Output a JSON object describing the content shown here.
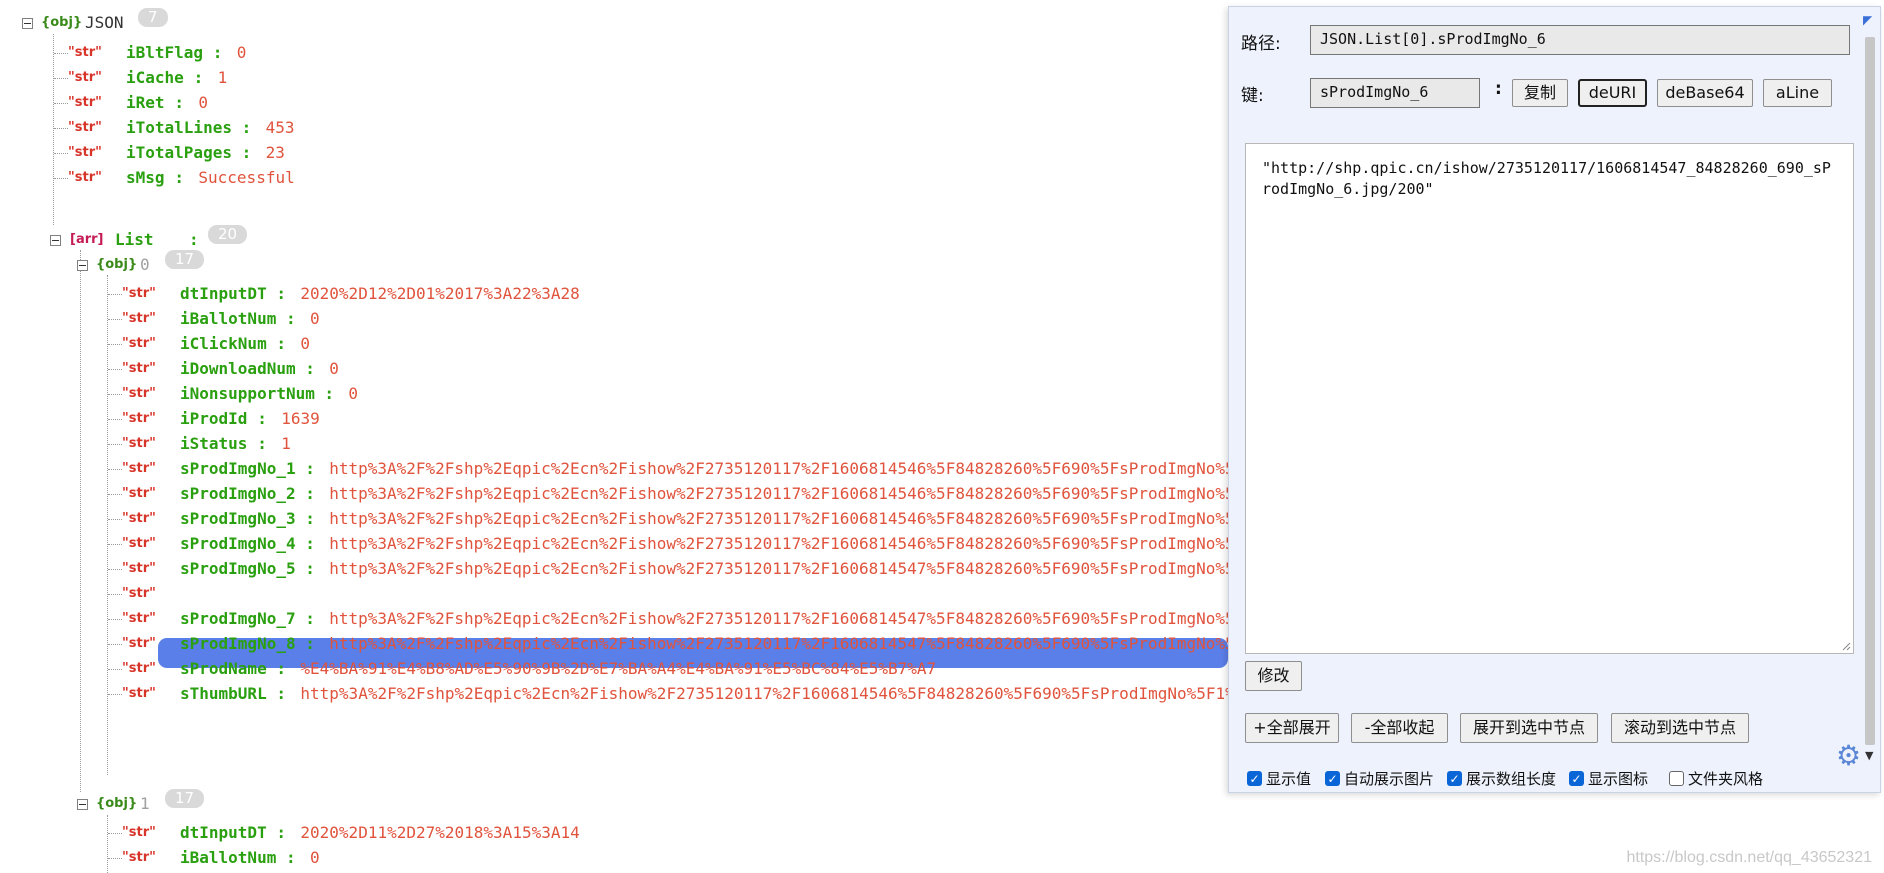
{
  "tree": {
    "root": {
      "type_tag": "{obj}",
      "name": "JSON",
      "count": "7"
    },
    "root_items": [
      {
        "type_tag": "\"str\"",
        "key": "iBltFlag",
        "value": "0"
      },
      {
        "type_tag": "\"str\"",
        "key": "iCache",
        "value": "1"
      },
      {
        "type_tag": "\"str\"",
        "key": "iRet",
        "value": "0"
      },
      {
        "type_tag": "\"str\"",
        "key": "iTotalLines",
        "value": "453"
      },
      {
        "type_tag": "\"str\"",
        "key": "iTotalPages",
        "value": "23"
      },
      {
        "type_tag": "\"str\"",
        "key": "sMsg",
        "value": "Successful"
      }
    ],
    "list": {
      "type_tag": "[arr]",
      "key": "List",
      "count": "20"
    },
    "obj0": {
      "type_tag": "{obj}",
      "index": "0",
      "count": "17"
    },
    "obj0_items": [
      {
        "type_tag": "\"str\"",
        "key": "dtInputDT",
        "value": "2020%2D12%2D01%2017%3A22%3A28"
      },
      {
        "type_tag": "\"str\"",
        "key": "iBallotNum",
        "value": "0"
      },
      {
        "type_tag": "\"str\"",
        "key": "iClickNum",
        "value": "0"
      },
      {
        "type_tag": "\"str\"",
        "key": "iDownloadNum",
        "value": "0"
      },
      {
        "type_tag": "\"str\"",
        "key": "iNonsupportNum",
        "value": "0"
      },
      {
        "type_tag": "\"str\"",
        "key": "iProdId",
        "value": "1639"
      },
      {
        "type_tag": "\"str\"",
        "key": "iStatus",
        "value": "1"
      },
      {
        "type_tag": "\"str\"",
        "key": "sProdImgNo_1",
        "value": "http%3A%2F%2Fshp%2Eqpic%2Ecn%2Fishow%2F2735120117%2F1606814546%5F84828260%5F690%5FsProdImgNo%5"
      },
      {
        "type_tag": "\"str\"",
        "key": "sProdImgNo_2",
        "value": "http%3A%2F%2Fshp%2Eqpic%2Ecn%2Fishow%2F2735120117%2F1606814546%5F84828260%5F690%5FsProdImgNo%5"
      },
      {
        "type_tag": "\"str\"",
        "key": "sProdImgNo_3",
        "value": "http%3A%2F%2Fshp%2Eqpic%2Ecn%2Fishow%2F2735120117%2F1606814546%5F84828260%5F690%5FsProdImgNo%5"
      },
      {
        "type_tag": "\"str\"",
        "key": "sProdImgNo_4",
        "value": "http%3A%2F%2Fshp%2Eqpic%2Ecn%2Fishow%2F2735120117%2F1606814546%5F84828260%5F690%5FsProdImgNo%5"
      },
      {
        "type_tag": "\"str\"",
        "key": "sProdImgNo_5",
        "value": "http%3A%2F%2Fshp%2Eqpic%2Ecn%2Fishow%2F2735120117%2F1606814547%5F84828260%5F690%5FsProdImgNo%5"
      },
      {
        "type_tag": "\"str\"",
        "key": "sProdImgNo_6",
        "value": "http%3A%2F%2Fshp%2Eqpic%2Ecn%2Fishow%2F2735120117%2F1606814547%5F84828260%5F690%5FsProdImgNo%5",
        "selected": true
      },
      {
        "type_tag": "\"str\"",
        "key": "sProdImgNo_7",
        "value": "http%3A%2F%2Fshp%2Eqpic%2Ecn%2Fishow%2F2735120117%2F1606814547%5F84828260%5F690%5FsProdImgNo%5"
      },
      {
        "type_tag": "\"str\"",
        "key": "sProdImgNo_8",
        "value": "http%3A%2F%2Fshp%2Eqpic%2Ecn%2Fishow%2F2735120117%2F1606814547%5F84828260%5F690%5FsProdImgNo%5"
      },
      {
        "type_tag": "\"str\"",
        "key": "sProdName",
        "value": "%E4%BA%91%E4%B8%AD%E5%90%9B%2D%E7%BA%A4%E4%BA%91%E5%BC%84%E5%B7%A7"
      },
      {
        "type_tag": "\"str\"",
        "key": "sThumbURL",
        "value": "http%3A%2F%2Fshp%2Eqpic%2Ecn%2Fishow%2F2735120117%2F1606814546%5F84828260%5F690%5FsProdImgNo%5F1%"
      }
    ],
    "obj1": {
      "type_tag": "{obj}",
      "index": "1",
      "count": "17"
    },
    "obj1_items": [
      {
        "type_tag": "\"str\"",
        "key": "dtInputDT",
        "value": "2020%2D11%2D27%2018%3A15%3A14"
      },
      {
        "type_tag": "\"str\"",
        "key": "iBallotNum",
        "value": "0"
      }
    ],
    "separator": ":"
  },
  "panel": {
    "path_label": "路径:",
    "path_value": "JSON.List[0].sProdImgNo_6",
    "key_label": "键:",
    "key_value": "sProdImgNo_6",
    "key_sep": ":",
    "copy_button": "复制",
    "deuri_button": "deURI",
    "debase64_button": "deBase64",
    "aline_button": "aLine",
    "value_text": "\"http://shp.qpic.cn/ishow/2735120117/1606814547_84828260_690_sProdImgNo_6.jpg/200\"",
    "modify_button": "修改",
    "expand_all_button": "+全部展开",
    "collapse_all_button": "-全部收起",
    "expand_to_selected_button": "展开到选中节点",
    "scroll_to_selected_button": "滚动到选中节点",
    "options": [
      {
        "label": "显示值",
        "checked": true
      },
      {
        "label": "自动展示图片",
        "checked": true
      },
      {
        "label": "展示数组长度",
        "checked": true
      },
      {
        "label": "显示图标",
        "checked": true
      },
      {
        "label": "文件夹风格",
        "checked": false
      }
    ],
    "settings_icon": "gear-icon"
  },
  "watermark": "https://blog.csdn.net/qq_43652321",
  "colors": {
    "selection": "#5b7fe8",
    "key": "#2aa010",
    "value": "#e0533c",
    "panel_bg": "#eef2fc"
  }
}
